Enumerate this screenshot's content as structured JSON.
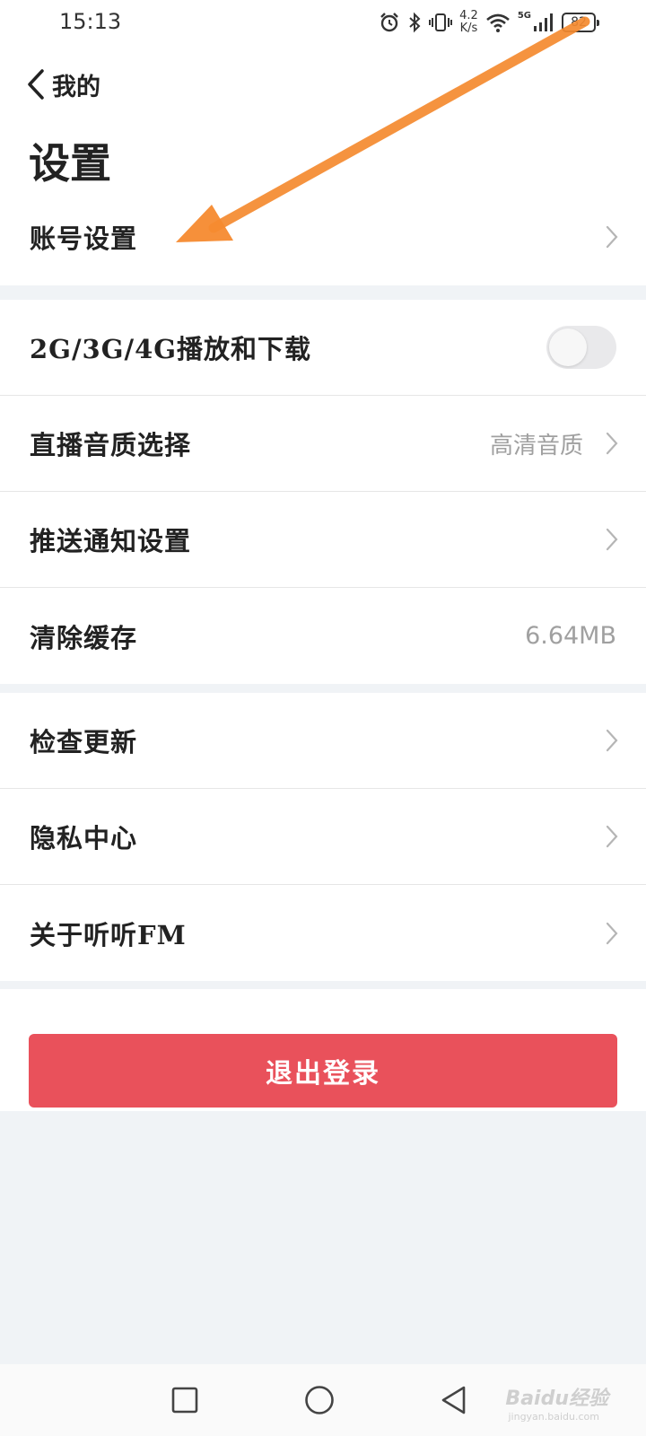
{
  "status_bar": {
    "time": "15:13",
    "speed_value": "4.2",
    "speed_unit": "K/s",
    "network": "5G",
    "battery": "82",
    "icons": [
      "alarm-icon",
      "bluetooth-icon",
      "vibrate-icon",
      "wifi-icon",
      "signal-icon",
      "battery-icon"
    ]
  },
  "header": {
    "back_label": "我的",
    "title": "设置"
  },
  "groups": [
    {
      "items": [
        {
          "label": "账号设置",
          "has_arrow": true
        }
      ]
    },
    {
      "items": [
        {
          "label": "2G/3G/4G播放和下载",
          "toggle": false
        },
        {
          "label": "直播音质选择",
          "value": "高清音质",
          "has_arrow": true
        },
        {
          "label": "推送通知设置",
          "has_arrow": true
        },
        {
          "label": "清除缓存",
          "value": "6.64MB",
          "has_arrow": false
        }
      ]
    },
    {
      "items": [
        {
          "label": "检查更新",
          "has_arrow": true
        },
        {
          "label": "隐私中心",
          "has_arrow": true
        },
        {
          "label": "关于听听FM",
          "has_arrow": true
        }
      ]
    }
  ],
  "logout": {
    "label": "退出登录"
  },
  "nav": {
    "icons": [
      "recents-icon",
      "home-icon",
      "back-icon"
    ]
  },
  "watermark": {
    "main": "Baidu经验",
    "sub": "jingyan.baidu.com"
  },
  "colors": {
    "background": "#f0f3f6",
    "logout": "#e9515b",
    "annotation_arrow": "#f58a2f",
    "secondary_text": "#a0a0a0"
  }
}
